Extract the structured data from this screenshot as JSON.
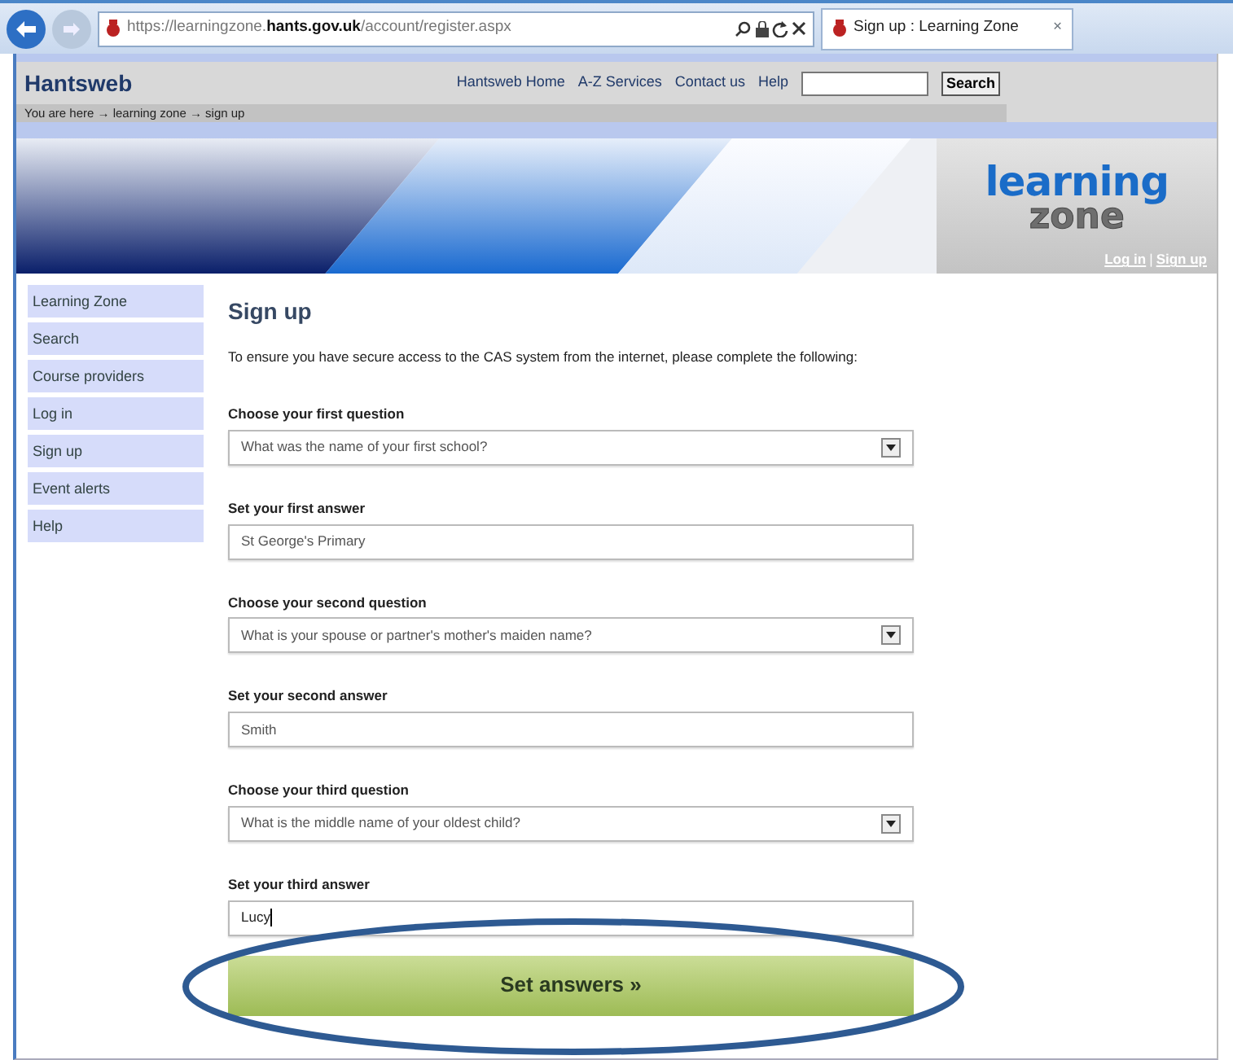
{
  "browser": {
    "url": "https://learningzone.**hants.gov.uk**/account/register.aspx",
    "tab_title": "Sign up : Learning Zone",
    "tab_close": "×"
  },
  "header": {
    "site_name": "Hantsweb",
    "nav": [
      "Hantsweb Home",
      "A-Z Services",
      "Contact us",
      "Help"
    ],
    "search_button": "Search",
    "breadcrumb": "You are here → learning zone → sign up"
  },
  "banner": {
    "logo_top": "learning",
    "logo_bottom": "zone",
    "links": [
      {
        "kind": "link",
        "text": "Log in"
      },
      {
        "kind": "separator",
        "text": "|"
      },
      {
        "kind": "link",
        "text": "Sign up"
      }
    ]
  },
  "sidebar": {
    "items": [
      "Learning Zone",
      "Search",
      "Course providers",
      "Log in",
      "Sign up",
      "Event alerts",
      "Help"
    ]
  },
  "form": {
    "title": "Sign up",
    "intro": "To ensure you have secure access to the CAS system from the internet, please complete the following:",
    "fields": [
      {
        "kind": "select",
        "label": "Choose your first question",
        "value": "What was the name of your first school?"
      },
      {
        "kind": "text",
        "label": "Set your first answer",
        "value": "St George's Primary"
      },
      {
        "kind": "select",
        "label": "Choose your second question",
        "value": "What is your spouse or partner's mother's maiden name?"
      },
      {
        "kind": "text",
        "label": "Set your second answer",
        "value": "Smith"
      },
      {
        "kind": "select",
        "label": "Choose your third question",
        "value": "What is the middle name of your oldest child?"
      },
      {
        "kind": "text",
        "label": "Set your third answer",
        "value": "Lucy",
        "focused": true
      }
    ],
    "submit": "Set answers »"
  }
}
